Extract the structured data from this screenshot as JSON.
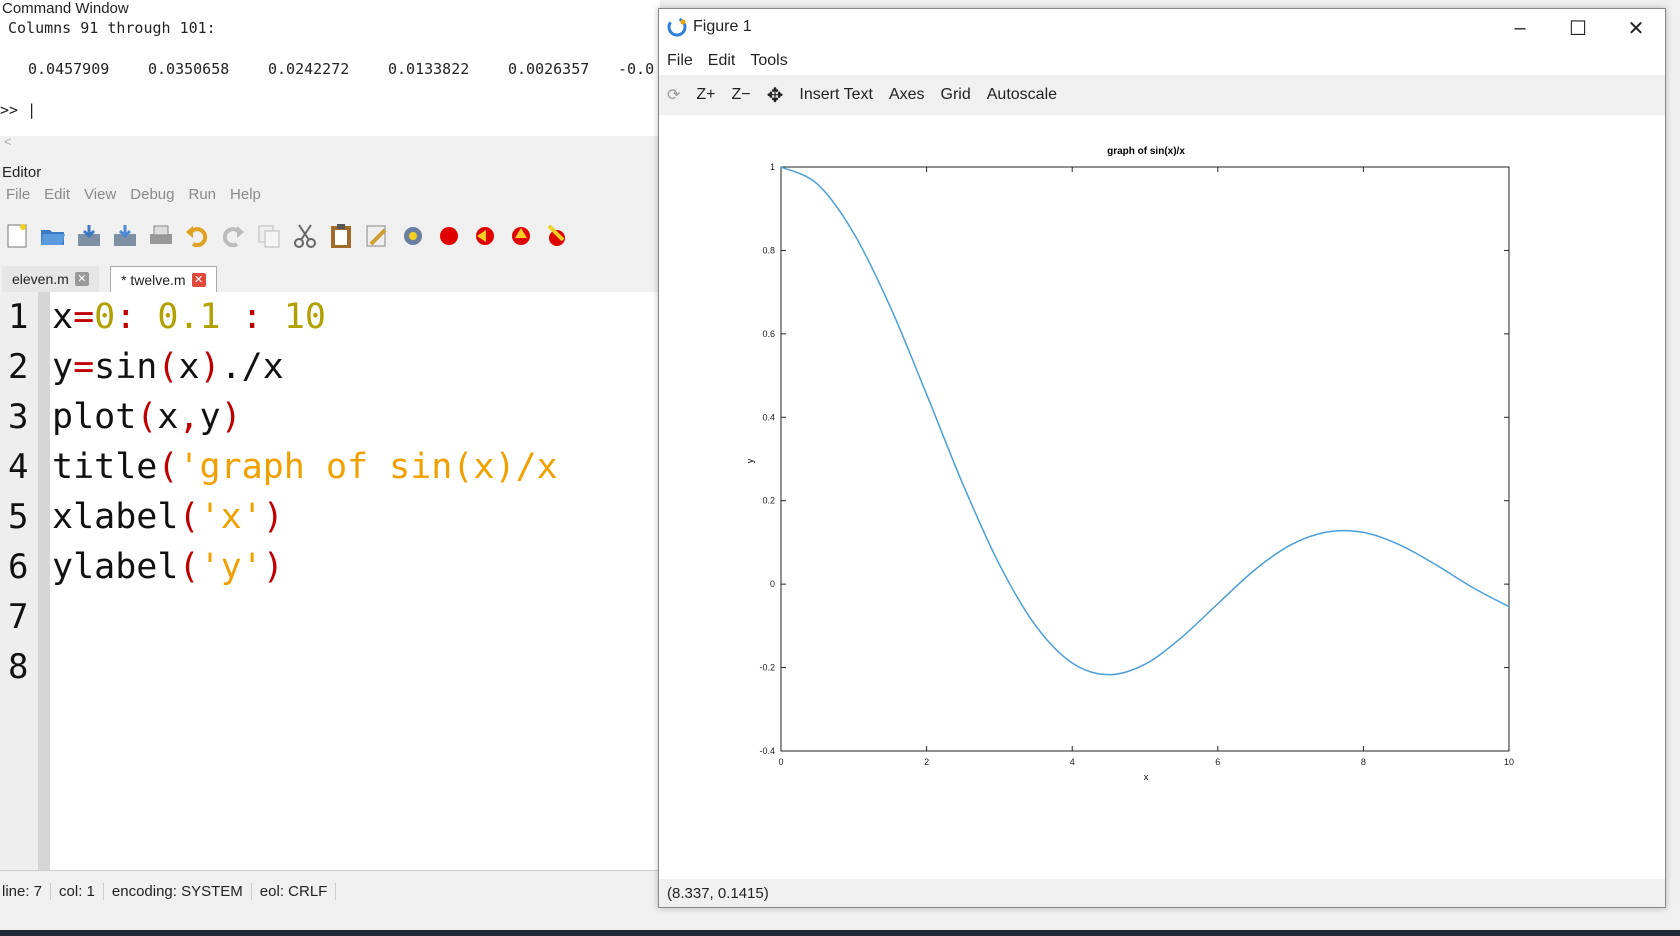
{
  "command_window": {
    "title": "Command Window",
    "header": "Columns 91 through 101:",
    "values": [
      "0.0457909",
      "0.0350658",
      "0.0242272",
      "0.0133822",
      "0.0026357",
      "-0.0"
    ],
    "prompt": ">> |",
    "scroll_arrow": "<"
  },
  "editor": {
    "title": "Editor",
    "menu": [
      "File",
      "Edit",
      "View",
      "Debug",
      "Run",
      "Help"
    ],
    "toolbar_icons": [
      "new-file-icon",
      "open-folder-icon",
      "save-icon",
      "save-as-icon",
      "print-icon",
      "undo-icon",
      "redo-icon",
      "copy-icon",
      "cut-icon",
      "paste-icon",
      "find-icon",
      "settings-icon",
      "breakpoint-icon",
      "step-in-icon",
      "step-out-icon",
      "clear-icon"
    ],
    "tabs": [
      {
        "label": "eleven.m",
        "active": false
      },
      {
        "label": "* twelve.m",
        "active": true
      }
    ],
    "line_numbers": [
      "1",
      "2",
      "3",
      "4",
      "5",
      "6",
      "7",
      "8"
    ],
    "status": {
      "line": "line: 7",
      "col": "col: 1",
      "encoding": "encoding: SYSTEM",
      "eol": "eol: CRLF"
    }
  },
  "figure": {
    "title": "Figure 1",
    "menu": [
      "File",
      "Edit",
      "Tools"
    ],
    "toolbar": [
      "Z+",
      "Z−",
      "Insert Text",
      "Axes",
      "Grid",
      "Autoscale"
    ],
    "coords": "(8.337, 0.1415)",
    "colors": {
      "line": "#4a9fd8"
    }
  },
  "chart_data": {
    "type": "line",
    "title": "graph of sin(x)/x",
    "xlabel": "x",
    "ylabel": "y",
    "xlim": [
      0,
      10
    ],
    "ylim": [
      -0.4,
      1
    ],
    "xticks": [
      "0",
      "2",
      "4",
      "6",
      "8",
      "10"
    ],
    "yticks": [
      "-0.4",
      "-0.2",
      "0",
      "0.2",
      "0.4",
      "0.6",
      "0.8",
      "1"
    ],
    "x": [
      0,
      0.5,
      1,
      1.5,
      2,
      2.5,
      3,
      3.5,
      4,
      4.5,
      5,
      5.5,
      6,
      6.5,
      7,
      7.5,
      8,
      8.5,
      9,
      9.5,
      10
    ],
    "y": [
      1,
      0.959,
      0.841,
      0.665,
      0.455,
      0.239,
      0.047,
      -0.1,
      -0.189,
      -0.217,
      -0.192,
      -0.128,
      -0.047,
      0.033,
      0.094,
      0.125,
      0.124,
      0.094,
      0.046,
      -0.008,
      -0.054
    ]
  }
}
